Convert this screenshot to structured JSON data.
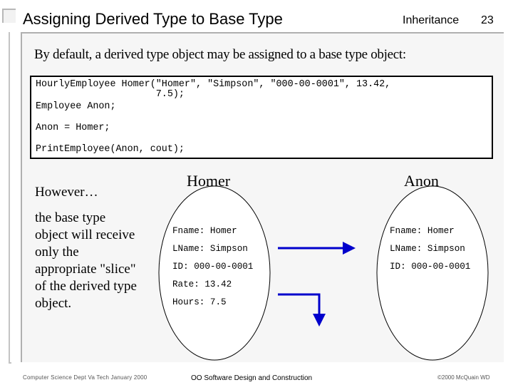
{
  "header": {
    "title": "Assigning Derived Type to Base Type",
    "section": "Inheritance",
    "page_number": "23"
  },
  "intro": "By default, a derived type object may be assigned to a base type object:",
  "code": {
    "lines": [
      "HourlyEmployee Homer(\"Homer\", \"Simpson\", \"000-00-0001\", 13.42,",
      "                     7.5);",
      "Employee Anon;",
      "Anon = Homer;",
      "PrintEmployee(Anon, cout);"
    ]
  },
  "explanation": {
    "heading": "However…",
    "body": "the base type object will receive only the appropriate \"slice\" of the derived type object."
  },
  "diagram": {
    "arrow_color": "#0000cc",
    "derived_object": {
      "name": "Homer",
      "fields": [
        "Fname: Homer",
        "LName: Simpson",
        "ID: 000-00-0001",
        "Rate: 13.42",
        "Hours: 7.5"
      ]
    },
    "base_object": {
      "name": "Anon",
      "fields": [
        "Fname: Homer",
        "LName: Simpson",
        "ID: 000-00-0001"
      ]
    }
  },
  "footer": {
    "left": "Computer Science Dept Va Tech January 2000",
    "center": "OO Software Design and Construction",
    "right": "©2000  McQuain WD"
  }
}
